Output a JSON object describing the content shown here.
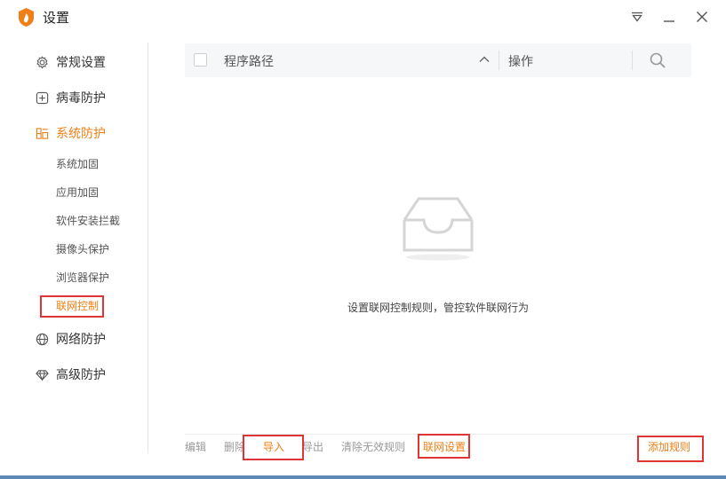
{
  "window": {
    "title": "设置"
  },
  "sidebar": {
    "items": [
      {
        "label": "常规设置",
        "icon": "gear-icon"
      },
      {
        "label": "病毒防护",
        "icon": "plus-box-icon"
      },
      {
        "label": "系统防护",
        "icon": "system-icon"
      },
      {
        "label": "网络防护",
        "icon": "globe-icon"
      },
      {
        "label": "高级防护",
        "icon": "diamond-icon"
      }
    ],
    "sub_items": [
      {
        "label": "系统加固"
      },
      {
        "label": "应用加固"
      },
      {
        "label": "软件安装拦截"
      },
      {
        "label": "摄像头保护"
      },
      {
        "label": "浏览器保护"
      },
      {
        "label": "联网控制"
      }
    ]
  },
  "table": {
    "col_path": "程序路径",
    "col_action": "操作"
  },
  "empty_state": {
    "text": "设置联网控制规则，管控软件联网行为"
  },
  "footer": {
    "edit": "编辑",
    "delete": "删除",
    "import": "导入",
    "export": "导出",
    "clear_invalid": "清除无效规则",
    "network_settings": "联网设置",
    "add_rule": "添加规则"
  },
  "colors": {
    "accent": "#f07f16",
    "highlight": "#e03535",
    "bottom_bar": "#5d89b6"
  }
}
